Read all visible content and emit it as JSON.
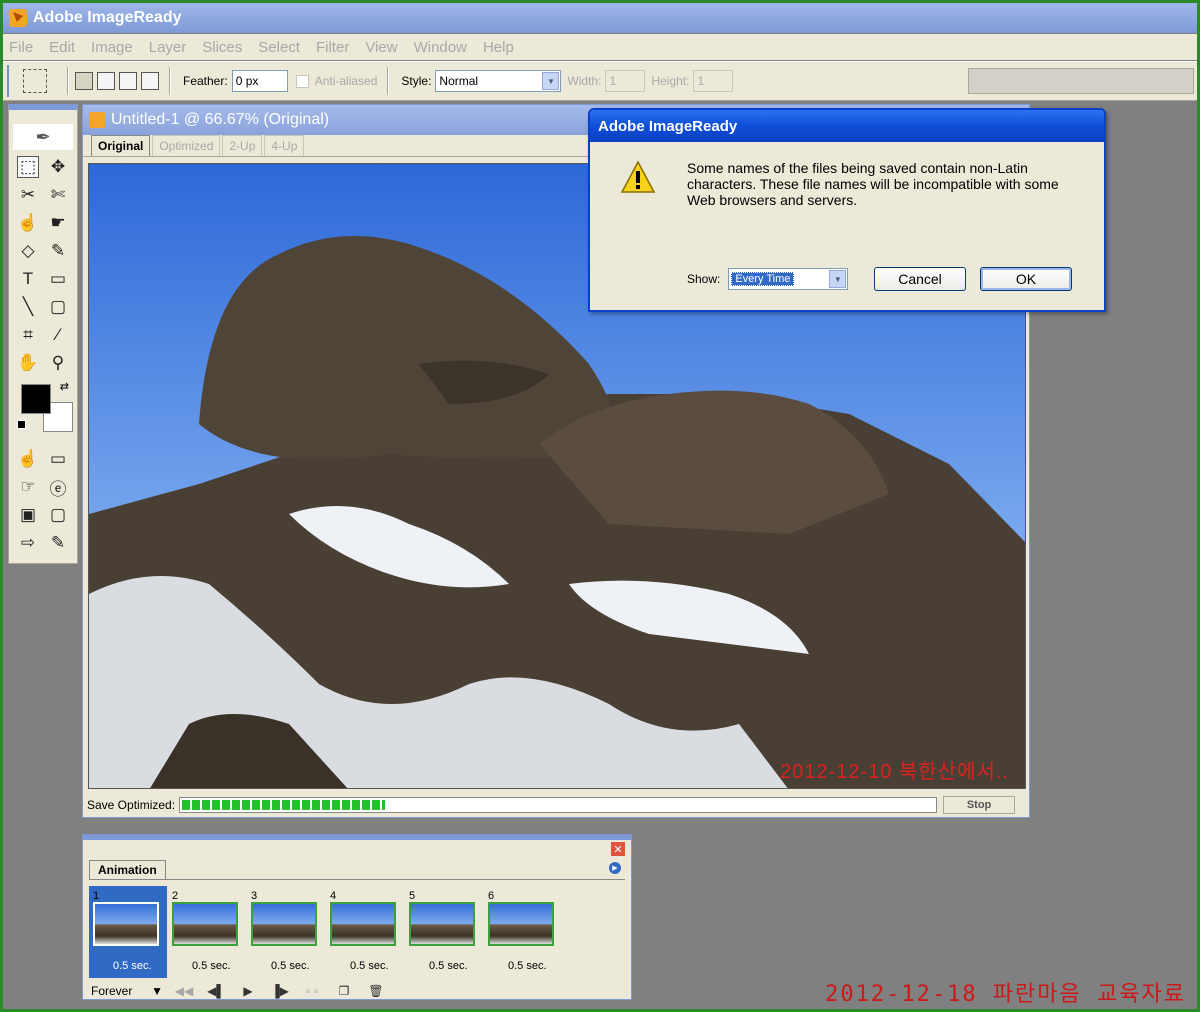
{
  "app": {
    "title": "Adobe ImageReady"
  },
  "menu": [
    "File",
    "Edit",
    "Image",
    "Layer",
    "Slices",
    "Select",
    "Filter",
    "View",
    "Window",
    "Help"
  ],
  "options": {
    "feather_label": "Feather:",
    "feather_value": "0 px",
    "antialiased_label": "Anti-aliased",
    "style_label": "Style:",
    "style_value": "Normal",
    "width_label": "Width:",
    "width_value": "1",
    "height_label": "Height:",
    "height_value": "1"
  },
  "toolbox": {
    "icons": [
      "imageready-logo-icon",
      "marquee-icon",
      "move-icon",
      "slice-icon",
      "slice-select-icon",
      "rollover-icon",
      "hand-cursor-icon",
      "eraser-icon",
      "brush-icon",
      "type-icon",
      "rectangle-icon",
      "line-icon",
      "rounded-rect-icon",
      "crop-icon",
      "eyedropper-icon",
      "hand-icon",
      "zoom-icon"
    ],
    "colors": {
      "foreground": "#000000",
      "background": "#ffffff"
    },
    "type_glyph": "T"
  },
  "document": {
    "title": "Untitled-1 @ 66.67% (Original)",
    "tabs": [
      "Original",
      "Optimized",
      "2-Up",
      "4-Up"
    ],
    "active_tab": "Original",
    "photo_caption": "2012-12-10 북한산에서..",
    "save_label": "Save Optimized:",
    "save_progress": 0.27,
    "stop_label": "Stop"
  },
  "dialog": {
    "title": "Adobe ImageReady",
    "message": "Some names of the files being saved contain non-Latin characters.  These file names will be incompatible with some Web browsers and servers.",
    "show_label": "Show:",
    "show_value": "Every Time",
    "cancel_label": "Cancel",
    "ok_label": "OK"
  },
  "animation": {
    "tab_label": "Animation",
    "frames": [
      {
        "number": "1",
        "delay": "0.5 sec."
      },
      {
        "number": "2",
        "delay": "0.5 sec."
      },
      {
        "number": "3",
        "delay": "0.5 sec."
      },
      {
        "number": "4",
        "delay": "0.5 sec."
      },
      {
        "number": "5",
        "delay": "0.5 sec."
      },
      {
        "number": "6",
        "delay": "0.5 sec."
      }
    ],
    "selected_frame": 1,
    "loop_value": "Forever"
  },
  "footer_caption": "2012-12-18 파란마음 교육자료"
}
